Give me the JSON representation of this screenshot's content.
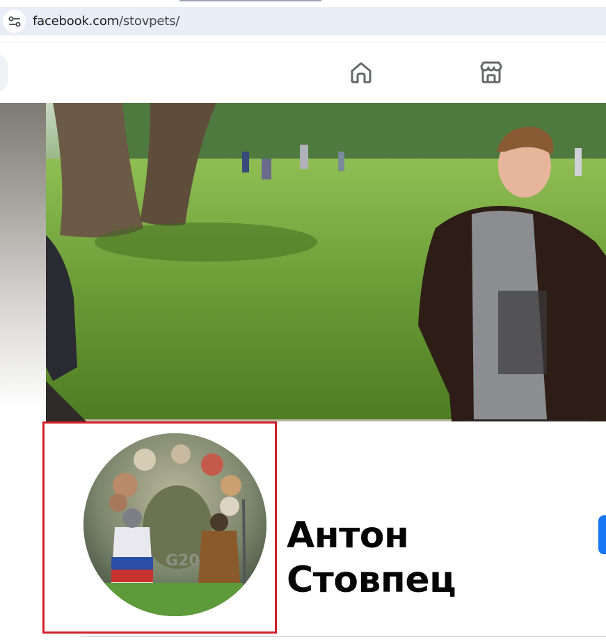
{
  "browser": {
    "url_host": "facebook.com",
    "url_path": "/stovpets/",
    "site_settings_icon": "site-settings-icon"
  },
  "fb_nav": {
    "home_icon": "home-icon",
    "marketplace_icon": "marketplace-icon"
  },
  "profile": {
    "name_line1": "Антон",
    "name_line2": "Стовпец"
  },
  "colors": {
    "highlight": "#d21f2a",
    "fb_blue": "#1877f2",
    "name_text": "#050505"
  }
}
